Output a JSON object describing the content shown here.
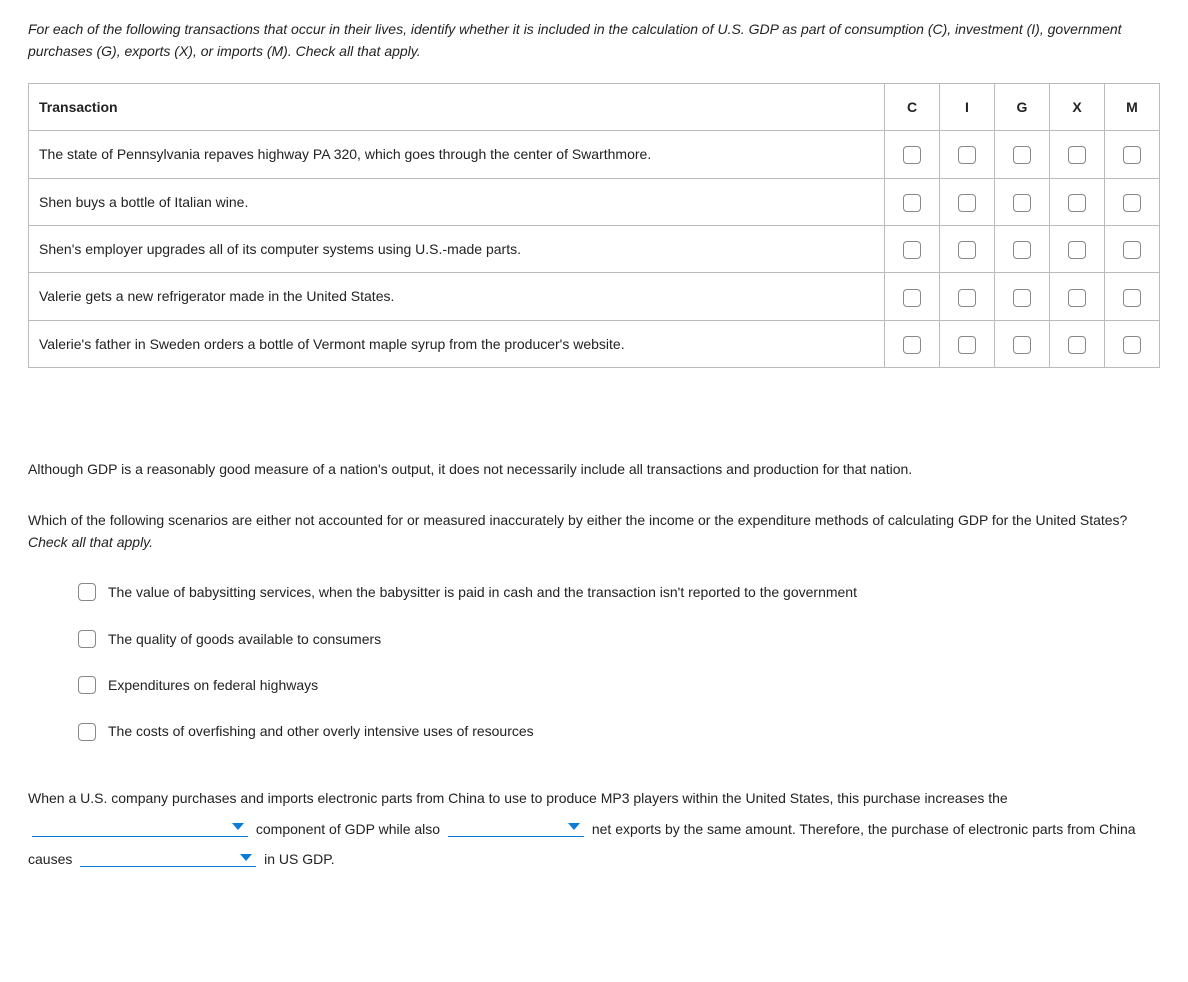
{
  "intro": "For each of the following transactions that occur in their lives, identify whether it is included in the calculation of U.S. GDP as part of consumption (C), investment (I), government purchases (G), exports (X), or imports (M). Check all that apply.",
  "table": {
    "header": {
      "transaction": "Transaction",
      "c": "C",
      "i": "I",
      "g": "G",
      "x": "X",
      "m": "M"
    },
    "rows": [
      {
        "text": "The state of Pennsylvania repaves highway PA 320, which goes through the center of Swarthmore."
      },
      {
        "text": "Shen buys a bottle of Italian wine."
      },
      {
        "text": "Shen's employer upgrades all of its computer systems using U.S.-made parts."
      },
      {
        "text": "Valerie gets a new refrigerator made in the United States."
      },
      {
        "text": "Valerie's father in Sweden orders a bottle of Vermont maple syrup from the producer's website."
      }
    ]
  },
  "paragraph1": "Although GDP is a reasonably good measure of a nation's output, it does not necessarily include all transactions and production for that nation.",
  "question2": {
    "lead": "Which of the following scenarios are either not accounted for or measured inaccurately by either the income or the expenditure methods of calculating GDP for the United States? ",
    "hint": "Check all that apply.",
    "options": [
      "The value of babysitting services, when the babysitter is paid in cash and the transaction isn't reported to the government",
      "The quality of goods available to consumers",
      "Expenditures on federal highways",
      "The costs of overfishing and other overly intensive uses of resources"
    ]
  },
  "fill": {
    "part1": "When a U.S. company purchases and imports electronic parts from China to use to produce MP3 players within the United States, this purchase increases the ",
    "part2": " component of GDP while also ",
    "part3": " net exports by the same amount. Therefore, the purchase of electronic parts from China causes ",
    "part4": " in US GDP."
  }
}
